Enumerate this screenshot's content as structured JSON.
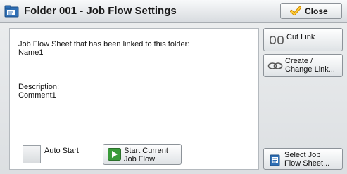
{
  "header": {
    "title": "Folder 001 - Job Flow Settings",
    "close_label": "Close"
  },
  "panel": {
    "linked_label": "Job Flow Sheet that has been linked to this folder:",
    "linked_value": "Name1",
    "description_label": "Description:",
    "description_value": "Comment1",
    "auto_start_label": "Auto Start",
    "start_line1": "Start Current",
    "start_line2": "Job Flow"
  },
  "side": {
    "cut_link_label": "Cut Link",
    "create_line1": "Create /",
    "create_line2": "Change Link...",
    "select_line1": "Select Job",
    "select_line2": "Flow Sheet..."
  }
}
